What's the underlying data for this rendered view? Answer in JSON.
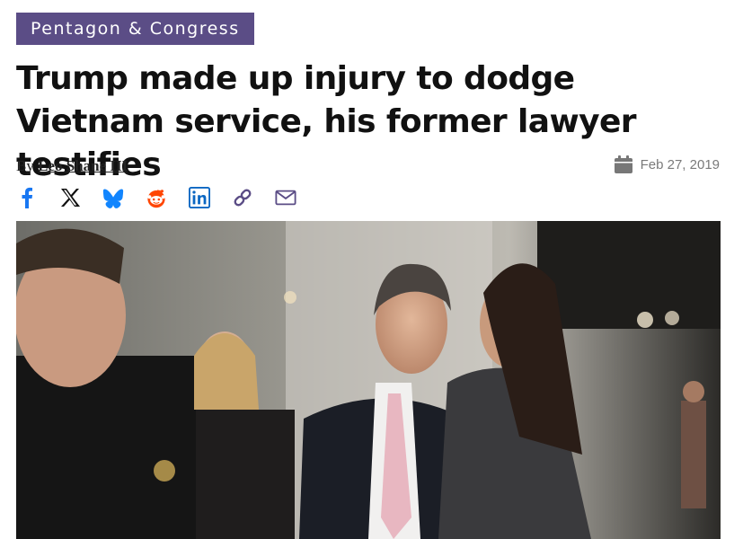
{
  "article": {
    "section_tag": "Pentagon & Congress",
    "headline": "Trump made up injury to dodge Vietnam service, his former lawyer testifies",
    "byline_prefix": "By",
    "author": "Leo Shane III",
    "date": "Feb 27, 2019"
  },
  "icons": {
    "calendar": "calendar-icon",
    "share": [
      "facebook-icon",
      "x-icon",
      "bluesky-icon",
      "reddit-icon",
      "linkedin-icon",
      "link-icon",
      "email-icon"
    ]
  },
  "colors": {
    "tag_background": "#5b4d86",
    "share_blue": "#1877f2",
    "reddit_orange": "#ff4500",
    "linkedin_blue": "#0a66c2",
    "link_purple": "#5b4d86"
  }
}
